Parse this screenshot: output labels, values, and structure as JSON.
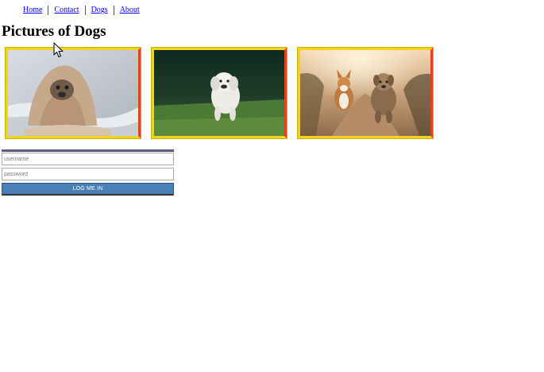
{
  "nav": {
    "items": [
      {
        "label": "Home"
      },
      {
        "label": "Contact"
      },
      {
        "label": "Dogs"
      },
      {
        "label": "About"
      }
    ]
  },
  "page": {
    "title": "Pictures of Dogs"
  },
  "gallery": {
    "frame_colors": {
      "border": "#f2d21c",
      "accent": "#e2441a"
    },
    "images": [
      {
        "subject": "pug wrapped in blanket",
        "icon": "pug-photo"
      },
      {
        "subject": "white dog running on grass",
        "icon": "white-dog-photo"
      },
      {
        "subject": "corgi and terrier running on path",
        "icon": "two-dogs-photo"
      }
    ]
  },
  "login": {
    "username_placeholder": "username",
    "password_placeholder": "password",
    "button_label": "LOG ME IN",
    "button_color": "#4a80b8"
  }
}
